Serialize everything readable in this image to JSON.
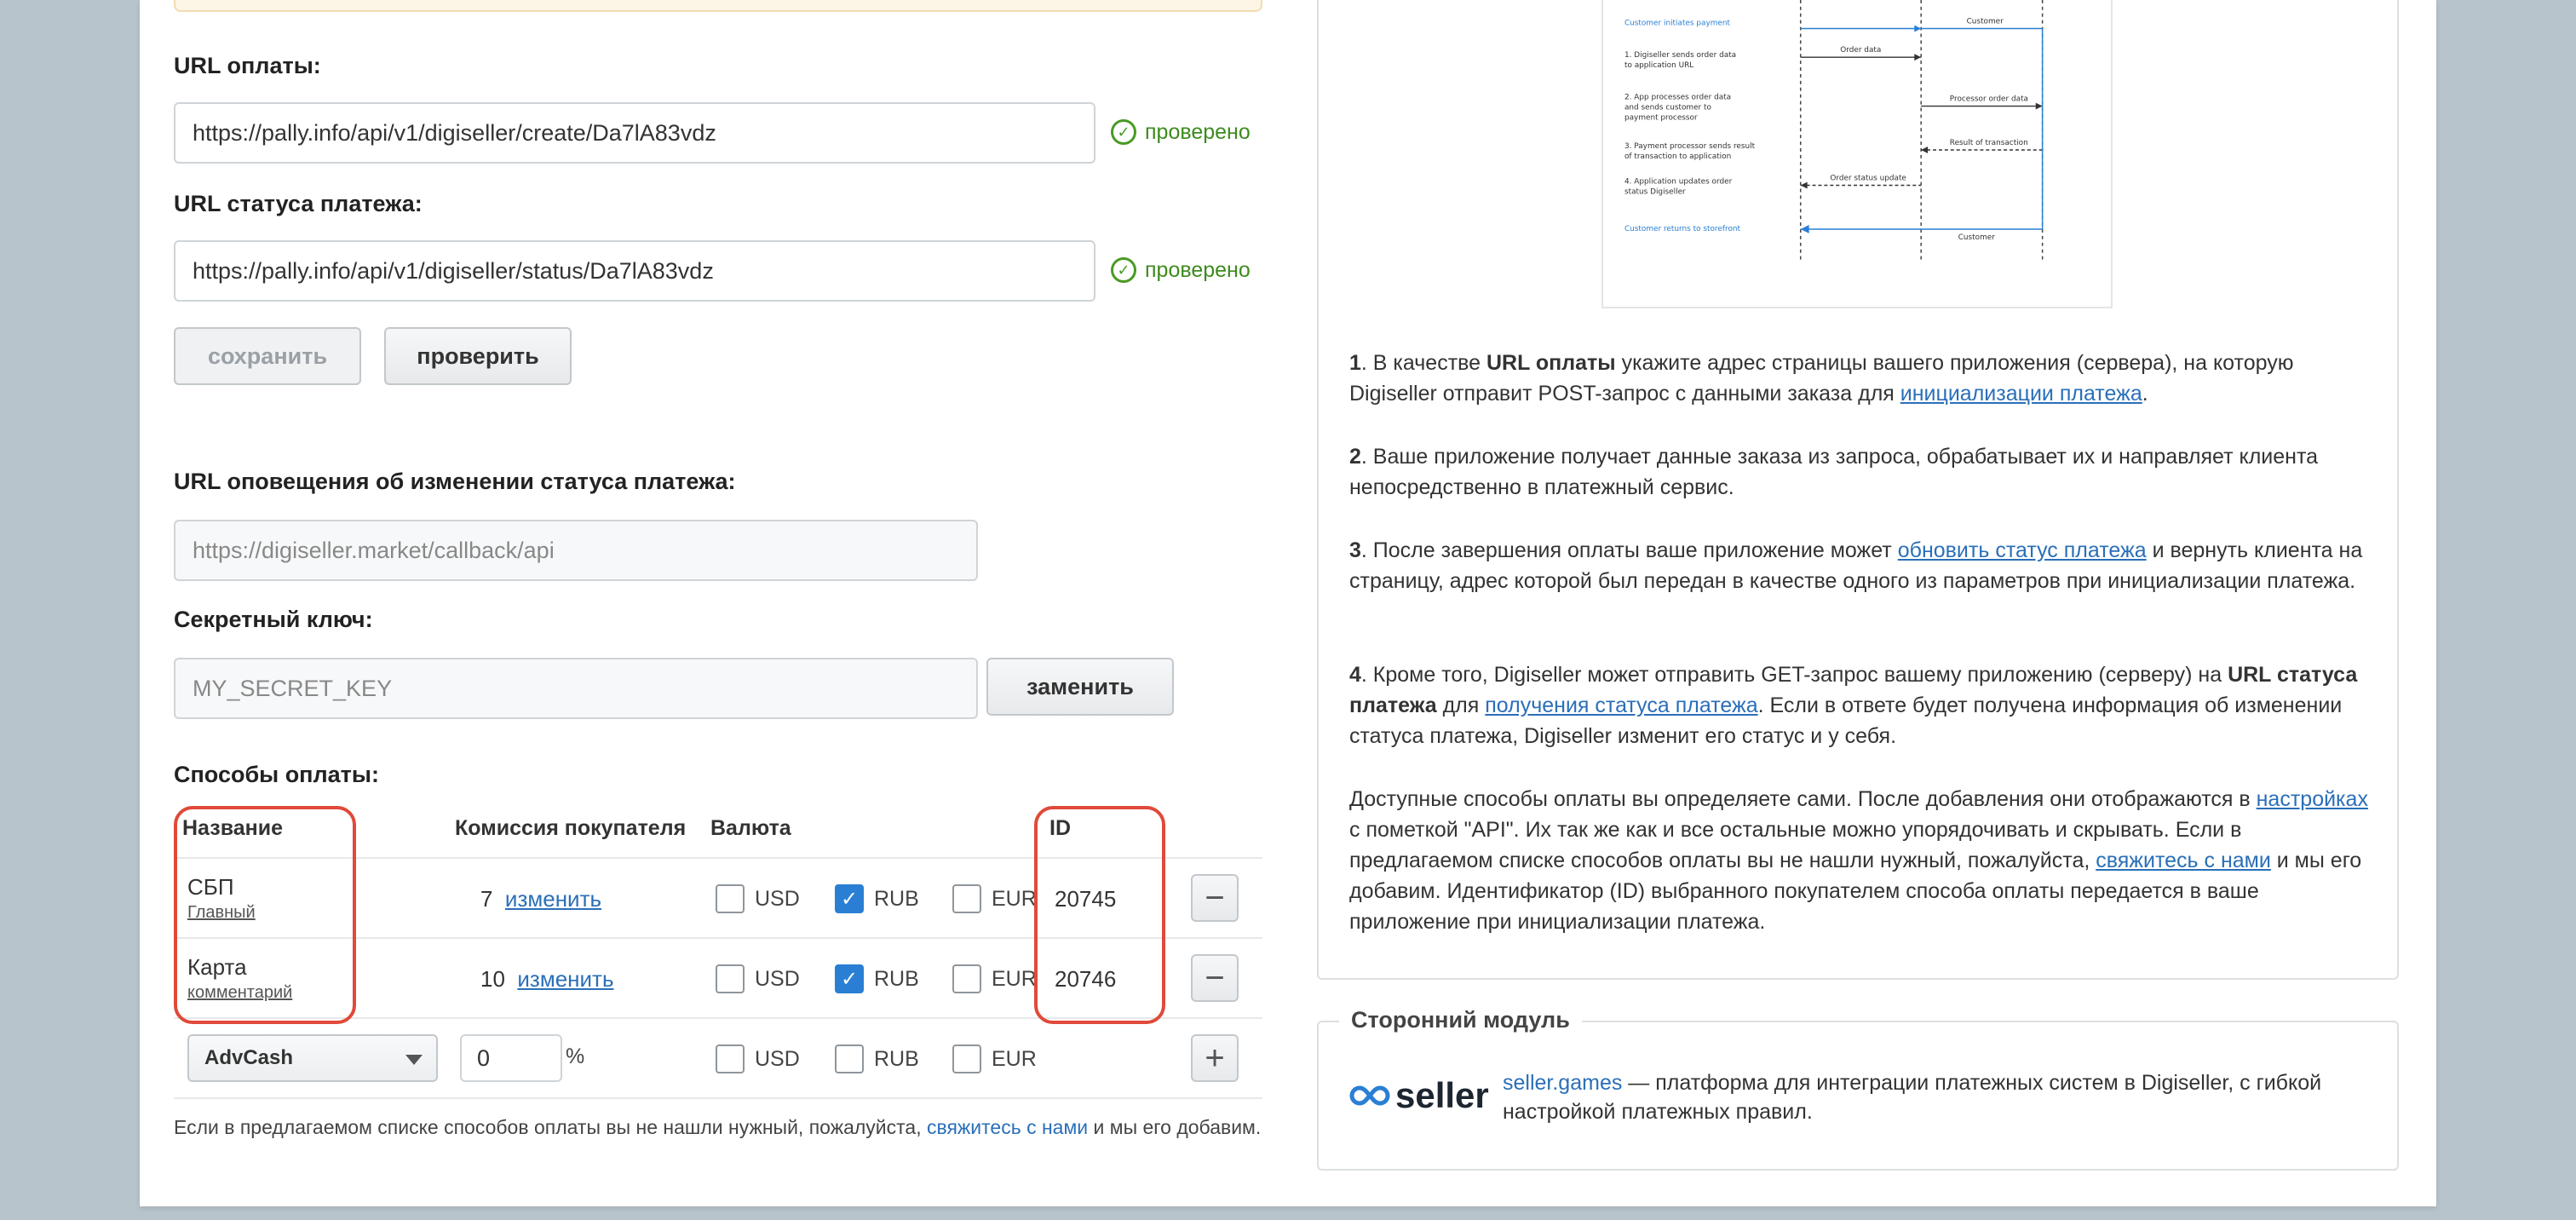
{
  "left": {
    "payment_url": {
      "label": "URL оплаты:",
      "value": "https://pally.info/api/v1/digiseller/create/Da7lA83vdz",
      "status": "проверено"
    },
    "status_url": {
      "label": "URL статуса платежа:",
      "value": "https://pally.info/api/v1/digiseller/status/Da7lA83vdz",
      "status": "проверено"
    },
    "buttons": {
      "save": "сохранить",
      "check": "проверить"
    },
    "callback": {
      "label": "URL оповещения об изменении статуса платежа:",
      "value": "https://digiseller.market/callback/api"
    },
    "secret": {
      "label": "Секретный ключ:",
      "value": "MY_SECRET_KEY",
      "replace_button": "заменить"
    },
    "methods": {
      "label": "Способы оплаты:",
      "headers": {
        "name": "Название",
        "commission": "Комиссия покупателя",
        "currency": "Валюта",
        "id": "ID"
      },
      "rows": [
        {
          "name": "СБП",
          "sub": "Главный",
          "commission": "7",
          "edit": "изменить",
          "usd": "USD",
          "rub": "RUB",
          "eur": "EUR",
          "id": "20745",
          "rub_checked": true
        },
        {
          "name": "Карта",
          "sub": "комментарий",
          "commission": "10",
          "edit": "изменить",
          "usd": "USD",
          "rub": "RUB",
          "eur": "EUR",
          "id": "20746",
          "rub_checked": true
        }
      ],
      "new_row": {
        "select": "AdvCash",
        "commission": "0",
        "percent": "%",
        "usd": "USD",
        "rub": "RUB",
        "eur": "EUR"
      }
    },
    "footnote": {
      "before": "Если в предлагаемом списке способов оплаты вы не нашли нужный, пожалуйста, ",
      "link": "свяжитесь с нами",
      "after": " и мы его добавим."
    }
  },
  "diagram": {
    "labels": {
      "initiates": "Customer initiates payment",
      "step1": "1. Digiseller sends order data",
      "step1b": "to application URL",
      "step2": "2. App processes order data",
      "step2b": "and sends customer to",
      "step2c": "payment processor",
      "step3": "3. Payment processor sends result",
      "step3b": "of transaction to application",
      "step4": "4. Application updates order",
      "step4b": "status Digiseller",
      "returns": "Customer returns to storefront",
      "customer": "Customer",
      "order_data": "Order data",
      "processor_data": "Processor order data",
      "result": "Result of transaction",
      "status_update": "Order status update",
      "customer2": "Customer"
    }
  },
  "right": {
    "p1": {
      "num": "1",
      "a": ". В качестве ",
      "b": "URL оплаты",
      "c": " укажите адрес страницы вашего приложения (сервера), на которую Digiseller отправит POST-запрос с данными заказа для ",
      "link": "инициализации платежа",
      "d": "."
    },
    "p2": {
      "num": "2",
      "text": ". Ваше приложение получает данные заказа из запроса, обрабатывает их и направляет клиента непосредственно в платежный сервис."
    },
    "p3": {
      "num": "3",
      "a": ". После завершения оплаты ваше приложение может ",
      "link": "обновить статус платежа",
      "b": " и вернуть клиента на страницу, адрес которой был передан в качестве одного из параметров при инициализации платежа."
    },
    "p4": {
      "num": "4",
      "a": ". Кроме того, Digiseller может отправить GET-запрос вашему приложению (серверу) на ",
      "b": "URL статуса платежа",
      "c": " для ",
      "link": "получения статуса платежа",
      "d": ". Если в ответе будет получена информация об изменении статуса платежа, Digiseller изменит его статус и у себя."
    },
    "p5": {
      "a": "Доступные способы оплаты вы определяете сами. После добавления они отображаются в ",
      "link1": "настройках",
      "b": " с пометкой \"API\". Их так же как и все остальные можно упорядочивать и скрывать. Если в предлагаемом списке способов оплаты вы не нашли нужный, пожалуйста, ",
      "link2": "свяжитесь с нами",
      "c": " и мы его добавим. Идентификатор (ID) выбранного покупателем способа оплаты передается в ваше приложение при инициализации платежа."
    },
    "module": {
      "title": "Сторонний модуль",
      "logo_text": "seller",
      "link": "seller.games",
      "text": " — платформа для интеграции платежных систем в Digiseller, с гибкой настройкой платежных правил."
    }
  }
}
